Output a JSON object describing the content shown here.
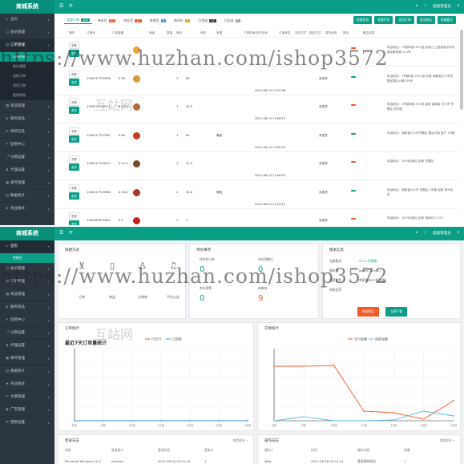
{
  "top": {
    "app_title": "商城系统",
    "user": "超级管理员",
    "sidebar": [
      {
        "label": "首页",
        "icon": "home-icon"
      },
      {
        "label": "会员管理",
        "icon": "user-icon"
      },
      {
        "label": "订单管理",
        "icon": "order-icon",
        "active": true
      },
      {
        "label": "商品管理",
        "icon": "goods-icon"
      },
      {
        "label": "服务商品",
        "icon": "service-icon"
      },
      {
        "label": "供货信息",
        "icon": "supply-icon"
      },
      {
        "label": "促销中心",
        "icon": "promo-icon"
      },
      {
        "label": "分销设置",
        "icon": "share-icon"
      },
      {
        "label": "代理设置",
        "icon": "agent-icon"
      },
      {
        "label": "库存管理",
        "icon": "stock-icon"
      },
      {
        "label": "数据统计",
        "icon": "stats-icon"
      },
      {
        "label": "商业版本",
        "icon": "vip-icon"
      }
    ],
    "submenu": [
      "订单列表",
      "售后管理",
      "退款订单",
      "退货订单",
      "提现转账"
    ],
    "tabs": [
      {
        "label": "全部订单",
        "count": "104",
        "color": "#0a9e87"
      },
      {
        "label": "待支付",
        "count": "37",
        "color": "#f05a28"
      },
      {
        "label": "待发货",
        "count": "17",
        "color": "#f05a28"
      },
      {
        "label": "待收货",
        "count": "6",
        "color": "#3a8ee6"
      },
      {
        "label": "待评价",
        "count": "1",
        "color": "#f0a020"
      },
      {
        "label": "已完成",
        "count": "24",
        "color": "#333"
      },
      {
        "label": "已关闭",
        "count": "6",
        "color": "#999"
      }
    ],
    "toolbar": [
      "批量发货",
      "批量打印",
      "导出订单",
      "导出商品",
      "批量备注"
    ],
    "columns": [
      "操作",
      "订单号",
      "订单金额",
      "商品",
      "数量",
      "单价",
      "状态",
      "来源",
      "下单时间/支付时间",
      "订单状态",
      "支付方式",
      "配送方式",
      "发货状态",
      "售后",
      "备注信息"
    ],
    "rows": [
      {
        "actions": [
          "查看",
          "发货"
        ],
        "order_no": "",
        "amount": "",
        "qty": "1",
        "price": "",
        "source": "",
        "time": "",
        "status": "",
        "note": "电话地址：1号楼B座1501室 赵祯江 山西省临汾市尧都区解放路 123号"
      },
      {
        "actions": [
          "查看",
          "发货"
        ],
        "order_no": "1162217732056",
        "amount": "¥ 50",
        "qty": "1",
        "price": "89",
        "source": "",
        "time": "2021-08-13 11:22:58",
        "status": "未发货",
        "note": "电话地址：1号楼B座 2501室 赵新 湖南省长沙市岳麓区麓谷大道100号"
      },
      {
        "actions": [
          "查看",
          "发货"
        ],
        "order_no": "1162217730511",
        "amount": "¥ 29.9",
        "qty": "1",
        "price": "29.9",
        "source": "",
        "time": "2021-08-13 11:06:15",
        "status": "未发货",
        "note": "电话地址：1号楼B座1501室 赵新 湖南省 长沙市 岳麓区 软件园"
      },
      {
        "actions": [
          "查看",
          "发货"
        ],
        "order_no": "1162217727392",
        "amount": "¥ 80",
        "qty": "1",
        "price": "89",
        "source": "微信",
        "time": "2021-08-13 11:09:22",
        "status": "未发货",
        "note": "电话地址：湖南省长沙市岳麓区 麓谷大道 客户 1号楼"
      },
      {
        "actions": [
          "查看",
          "发货"
        ],
        "order_no": "1162217724913",
        "amount": "¥ 21.9",
        "qty": "1",
        "price": "21.9",
        "source": "",
        "time": "2021-08-13 11:06:51",
        "status": "未发货",
        "note": "电话地址：1619赵新区 赵新 岳麓区"
      },
      {
        "actions": [
          "查看",
          "发货"
        ],
        "order_no": "1162217720996",
        "amount": "¥ 34.8",
        "qty": "1",
        "price": "34.8",
        "source": "微信",
        "time": "2021-08-13 11:10:12",
        "status": "未发货",
        "note": "电话地址：湖南省长沙市 岳麓区 1号楼 赵新 郑州大学"
      },
      {
        "actions": [
          "查看",
          "发货"
        ],
        "order_no": "1162384975561",
        "amount": "¥ 1",
        "qty": "1",
        "price": "1",
        "source": "",
        "time": "2021-08-13 11:05:23",
        "status": "未发货",
        "note": "电话地址：1619赵新区 赵新 湖南长沙 123"
      }
    ]
  },
  "bottom": {
    "app_title": "商城系统",
    "user": "超级管理员",
    "sidebar": [
      {
        "label": "首页",
        "icon": "home-icon",
        "active": true
      },
      {
        "label": "会员管理",
        "icon": "user-icon"
      },
      {
        "label": "订单管理",
        "icon": "order-icon"
      },
      {
        "label": "商品管理",
        "icon": "goods-icon"
      },
      {
        "label": "服务商品",
        "icon": "service-icon"
      },
      {
        "label": "促销中心",
        "icon": "promo-icon"
      },
      {
        "label": "分销设置",
        "icon": "share-icon"
      },
      {
        "label": "代理设置",
        "icon": "agent-icon"
      },
      {
        "label": "库存管理",
        "icon": "stock-icon"
      },
      {
        "label": "数据统计",
        "icon": "stats-icon"
      },
      {
        "label": "商业版本",
        "icon": "vip-icon"
      },
      {
        "label": "文章管理",
        "icon": "article-icon"
      },
      {
        "label": "广告管理",
        "icon": "ad-icon"
      },
      {
        "label": "营销设置",
        "icon": "setting-icon"
      }
    ],
    "submenu": [
      "控制台"
    ],
    "quick": {
      "title": "快捷方式",
      "items": [
        {
          "label": "订单",
          "icon": "cart-icon"
        },
        {
          "label": "商品",
          "icon": "doc-icon"
        },
        {
          "label": "分销商",
          "icon": "person-icon"
        },
        {
          "label": "平台公告",
          "icon": "bell-icon"
        }
      ]
    },
    "todo": {
      "title": "待办事项",
      "items": [
        {
          "label": "待发货订单",
          "value": "0",
          "color": "#0a9e87"
        },
        {
          "label": "待处理售后",
          "value": "0",
          "color": "#0a9e87"
        },
        {
          "label": "库存预警",
          "value": "0",
          "color": "#0a9e87"
        },
        {
          "label": "待审核",
          "value": "9",
          "color": "#f05a28"
        }
      ]
    },
    "version": {
      "title": "版本信息",
      "rows": [
        {
          "k": "当前版本",
          "v": "5.1.0 开源版"
        },
        {
          "k": "服务器",
          "v": "Nginx Core 5.1"
        },
        {
          "k": "运营类型",
          "v": "商家版(B2C多店铺)"
        },
        {
          "k": "授权信息",
          "v": ""
        }
      ],
      "btn_buy": "授权购买",
      "btn_download": "立即下载"
    },
    "order_chart": {
      "title": "订单统计",
      "heading": "最近7天订单量统计",
      "legend": [
        "已支付",
        "已退款"
      ]
    },
    "sales_chart": {
      "title": "交易统计",
      "legend": [
        "支付金额",
        "退款金额"
      ]
    },
    "login_log": {
      "title": "登录日志",
      "more": "查看更多 >",
      "cols": [
        "系统",
        "登录账户",
        "登录时间",
        "登录IP"
      ],
      "row": [
        "Microsoft Windows 10.0",
        "jiemake",
        "2021-08-16 09:22:44",
        "1"
      ]
    },
    "op_log": {
      "title": "操作日志",
      "more": "查看更多 >",
      "cols": [
        "操作人",
        "时间",
        "操作内容",
        "结果"
      ],
      "row": [
        "Web",
        "2021-08-16 09:22:44",
        "登录操作成功",
        "1"
      ]
    }
  },
  "chart_data": [
    {
      "type": "line",
      "title": "最近7天订单量统计",
      "x": [
        "8日",
        "9日",
        "10日",
        "11日",
        "12日",
        "13日",
        "14日"
      ],
      "series": [
        {
          "name": "已支付",
          "values": [
            0,
            0,
            0,
            0,
            0,
            0,
            0
          ],
          "color": "#f05a28"
        },
        {
          "name": "已退款",
          "values": [
            0,
            0,
            0,
            0,
            0,
            0,
            0
          ],
          "color": "#3a8ee6"
        }
      ],
      "ylim": [
        0,
        1
      ]
    },
    {
      "type": "line",
      "x": [
        "8日",
        "9日",
        "10日",
        "11日",
        "12日",
        "13日",
        "14日"
      ],
      "series": [
        {
          "name": "支付金额",
          "values": [
            68,
            68,
            69,
            12,
            10,
            2,
            25
          ],
          "color": "#f05a28"
        },
        {
          "name": "退款金额",
          "values": [
            0,
            5,
            0,
            0,
            1,
            12,
            6
          ],
          "color": "#5bc0de"
        }
      ],
      "ylim": [
        0,
        90
      ]
    }
  ],
  "watermark": {
    "line1": "https://www.huzhan.com/ishop3572",
    "line2": "互站网"
  }
}
